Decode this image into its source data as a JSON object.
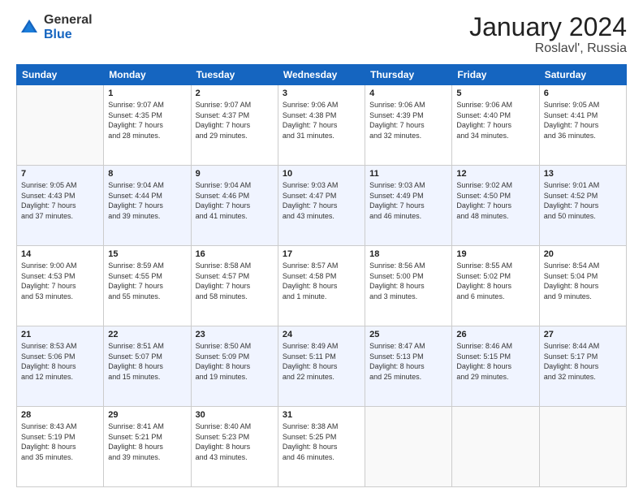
{
  "header": {
    "logo_general": "General",
    "logo_blue": "Blue",
    "month_year": "January 2024",
    "location": "Roslavl', Russia"
  },
  "days_of_week": [
    "Sunday",
    "Monday",
    "Tuesday",
    "Wednesday",
    "Thursday",
    "Friday",
    "Saturday"
  ],
  "weeks": [
    [
      {
        "num": "",
        "info": ""
      },
      {
        "num": "1",
        "info": "Sunrise: 9:07 AM\nSunset: 4:35 PM\nDaylight: 7 hours\nand 28 minutes."
      },
      {
        "num": "2",
        "info": "Sunrise: 9:07 AM\nSunset: 4:37 PM\nDaylight: 7 hours\nand 29 minutes."
      },
      {
        "num": "3",
        "info": "Sunrise: 9:06 AM\nSunset: 4:38 PM\nDaylight: 7 hours\nand 31 minutes."
      },
      {
        "num": "4",
        "info": "Sunrise: 9:06 AM\nSunset: 4:39 PM\nDaylight: 7 hours\nand 32 minutes."
      },
      {
        "num": "5",
        "info": "Sunrise: 9:06 AM\nSunset: 4:40 PM\nDaylight: 7 hours\nand 34 minutes."
      },
      {
        "num": "6",
        "info": "Sunrise: 9:05 AM\nSunset: 4:41 PM\nDaylight: 7 hours\nand 36 minutes."
      }
    ],
    [
      {
        "num": "7",
        "info": "Sunrise: 9:05 AM\nSunset: 4:43 PM\nDaylight: 7 hours\nand 37 minutes."
      },
      {
        "num": "8",
        "info": "Sunrise: 9:04 AM\nSunset: 4:44 PM\nDaylight: 7 hours\nand 39 minutes."
      },
      {
        "num": "9",
        "info": "Sunrise: 9:04 AM\nSunset: 4:46 PM\nDaylight: 7 hours\nand 41 minutes."
      },
      {
        "num": "10",
        "info": "Sunrise: 9:03 AM\nSunset: 4:47 PM\nDaylight: 7 hours\nand 43 minutes."
      },
      {
        "num": "11",
        "info": "Sunrise: 9:03 AM\nSunset: 4:49 PM\nDaylight: 7 hours\nand 46 minutes."
      },
      {
        "num": "12",
        "info": "Sunrise: 9:02 AM\nSunset: 4:50 PM\nDaylight: 7 hours\nand 48 minutes."
      },
      {
        "num": "13",
        "info": "Sunrise: 9:01 AM\nSunset: 4:52 PM\nDaylight: 7 hours\nand 50 minutes."
      }
    ],
    [
      {
        "num": "14",
        "info": "Sunrise: 9:00 AM\nSunset: 4:53 PM\nDaylight: 7 hours\nand 53 minutes."
      },
      {
        "num": "15",
        "info": "Sunrise: 8:59 AM\nSunset: 4:55 PM\nDaylight: 7 hours\nand 55 minutes."
      },
      {
        "num": "16",
        "info": "Sunrise: 8:58 AM\nSunset: 4:57 PM\nDaylight: 7 hours\nand 58 minutes."
      },
      {
        "num": "17",
        "info": "Sunrise: 8:57 AM\nSunset: 4:58 PM\nDaylight: 8 hours\nand 1 minute."
      },
      {
        "num": "18",
        "info": "Sunrise: 8:56 AM\nSunset: 5:00 PM\nDaylight: 8 hours\nand 3 minutes."
      },
      {
        "num": "19",
        "info": "Sunrise: 8:55 AM\nSunset: 5:02 PM\nDaylight: 8 hours\nand 6 minutes."
      },
      {
        "num": "20",
        "info": "Sunrise: 8:54 AM\nSunset: 5:04 PM\nDaylight: 8 hours\nand 9 minutes."
      }
    ],
    [
      {
        "num": "21",
        "info": "Sunrise: 8:53 AM\nSunset: 5:06 PM\nDaylight: 8 hours\nand 12 minutes."
      },
      {
        "num": "22",
        "info": "Sunrise: 8:51 AM\nSunset: 5:07 PM\nDaylight: 8 hours\nand 15 minutes."
      },
      {
        "num": "23",
        "info": "Sunrise: 8:50 AM\nSunset: 5:09 PM\nDaylight: 8 hours\nand 19 minutes."
      },
      {
        "num": "24",
        "info": "Sunrise: 8:49 AM\nSunset: 5:11 PM\nDaylight: 8 hours\nand 22 minutes."
      },
      {
        "num": "25",
        "info": "Sunrise: 8:47 AM\nSunset: 5:13 PM\nDaylight: 8 hours\nand 25 minutes."
      },
      {
        "num": "26",
        "info": "Sunrise: 8:46 AM\nSunset: 5:15 PM\nDaylight: 8 hours\nand 29 minutes."
      },
      {
        "num": "27",
        "info": "Sunrise: 8:44 AM\nSunset: 5:17 PM\nDaylight: 8 hours\nand 32 minutes."
      }
    ],
    [
      {
        "num": "28",
        "info": "Sunrise: 8:43 AM\nSunset: 5:19 PM\nDaylight: 8 hours\nand 35 minutes."
      },
      {
        "num": "29",
        "info": "Sunrise: 8:41 AM\nSunset: 5:21 PM\nDaylight: 8 hours\nand 39 minutes."
      },
      {
        "num": "30",
        "info": "Sunrise: 8:40 AM\nSunset: 5:23 PM\nDaylight: 8 hours\nand 43 minutes."
      },
      {
        "num": "31",
        "info": "Sunrise: 8:38 AM\nSunset: 5:25 PM\nDaylight: 8 hours\nand 46 minutes."
      },
      {
        "num": "",
        "info": ""
      },
      {
        "num": "",
        "info": ""
      },
      {
        "num": "",
        "info": ""
      }
    ]
  ]
}
